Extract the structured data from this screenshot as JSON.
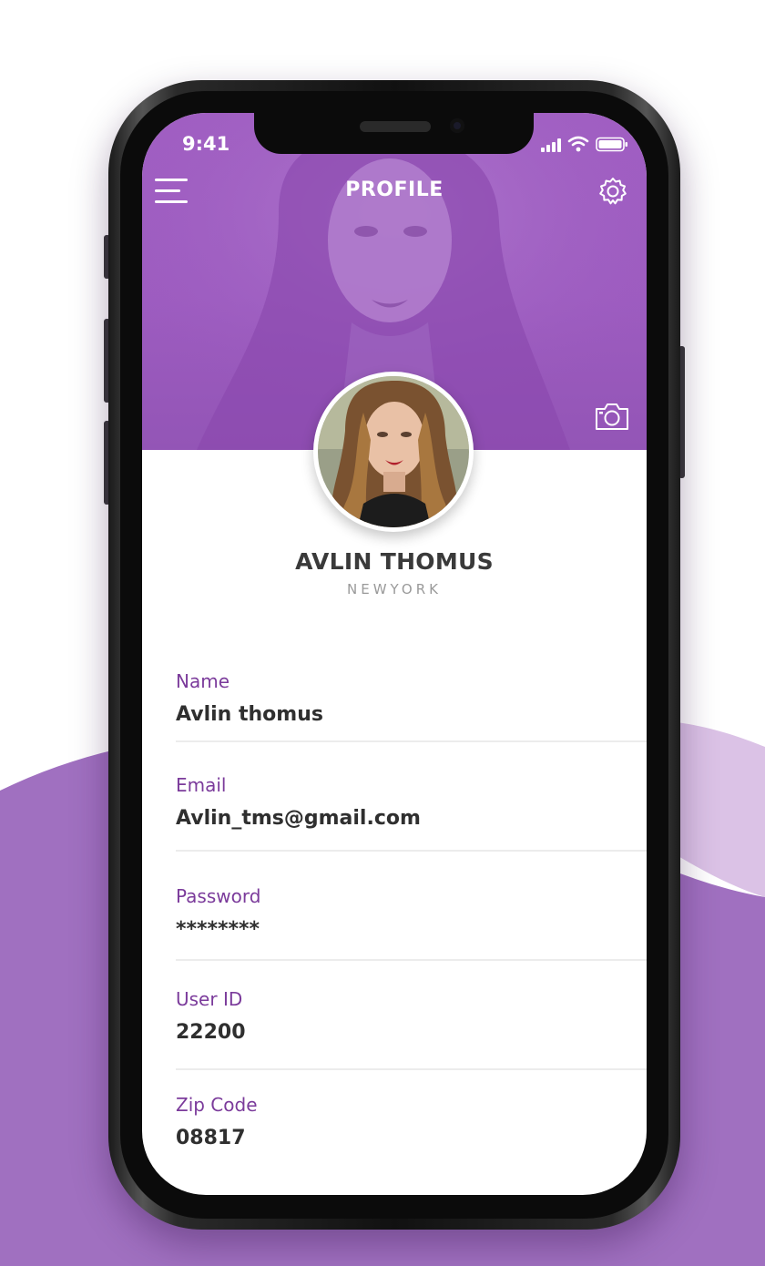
{
  "colors": {
    "brand_purple": "#9d5cc0",
    "label_purple": "#7b3b9b",
    "bg_wave_light": "#dbc2e6",
    "bg_wave": "#a070c0"
  },
  "status_bar": {
    "time": "9:41"
  },
  "header": {
    "title": "PROFILE",
    "menu_icon": "hamburger-menu-icon",
    "settings_icon": "gear-icon",
    "camera_icon": "camera-icon"
  },
  "profile": {
    "name": "AVLIN THOMUS",
    "city": "NEWYORK"
  },
  "fields": [
    {
      "label": "Name",
      "value": "Avlin thomus"
    },
    {
      "label": "Email",
      "value": "Avlin_tms@gmail.com"
    },
    {
      "label": "Password",
      "value": "********"
    },
    {
      "label": "User ID",
      "value": "22200"
    },
    {
      "label": "Zip Code",
      "value": "08817"
    }
  ]
}
